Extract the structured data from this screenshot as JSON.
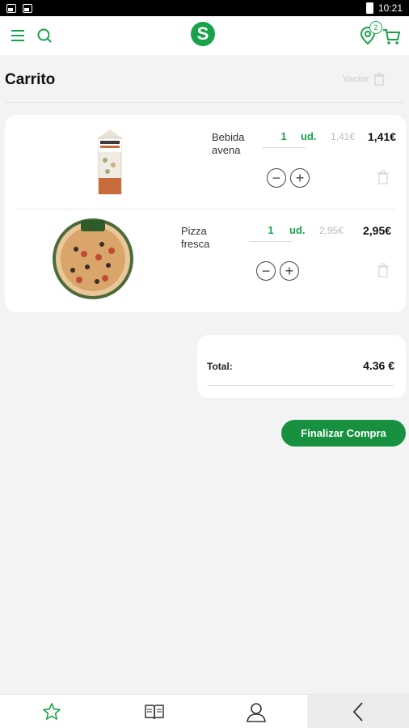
{
  "status_bar": {
    "time": "10:21"
  },
  "header": {
    "logo_letter": "S",
    "cart_count": "2",
    "icons": [
      "menu-icon",
      "search-icon",
      "location-icon",
      "cart-icon"
    ],
    "accent_color": "#17a34a"
  },
  "page": {
    "title": "Carrito",
    "empty_label": "Vaciar"
  },
  "items": [
    {
      "name_line1": "Bebida",
      "name_line2": "avena",
      "quantity": "1",
      "unit": "ud.",
      "unit_price": "1,41€",
      "price": "1,41€"
    },
    {
      "name_line1": "Pizza",
      "name_line2": "fresca",
      "quantity": "1",
      "unit": "ud.",
      "unit_price": "2,95€",
      "price": "2,95€"
    }
  ],
  "summary": {
    "total_label": "Total:",
    "total_value": "4.36 €"
  },
  "checkout": {
    "label": "Finalizar Compra",
    "color": "#17913f"
  },
  "bottom_nav": {
    "icons": [
      "star-icon",
      "book-icon",
      "user-icon",
      "back-icon"
    ]
  }
}
